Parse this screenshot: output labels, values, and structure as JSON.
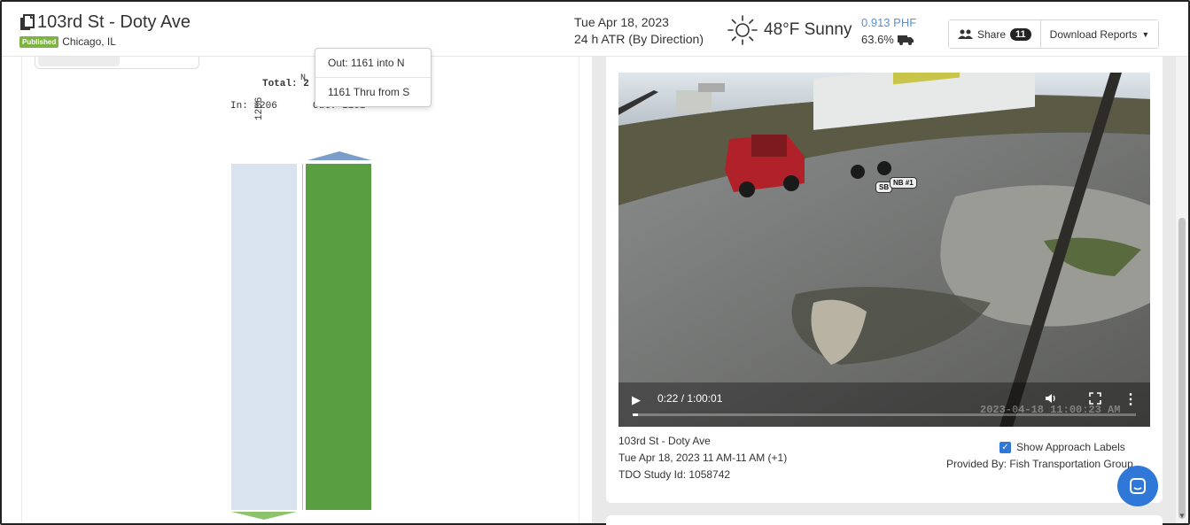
{
  "header": {
    "title": "103rd St - Doty Ave",
    "badge": "Published",
    "location": "Chicago, IL",
    "date": "Tue Apr 18, 2023",
    "study_type": "24 h ATR (By Direction)",
    "weather": "48°F Sunny",
    "phf": "0.913 PHF",
    "truck_pct": "63.6%",
    "share_label": "Share",
    "share_count": "11",
    "download_label": "Download Reports"
  },
  "diagram": {
    "n_label": "N",
    "total_label": "Total: 2",
    "in_label": "In: 1206",
    "out_label": "Out: 1161",
    "vertical_in": "1206",
    "tooltip_out": "Out: 1161 into N",
    "tooltip_thru": "1161 Thru from S"
  },
  "video": {
    "time": "0:22 / 1:00:01",
    "progress": 0.006,
    "timestamp": "2023-04-18 11:00:23 AM",
    "approach_nb": "NB #1",
    "approach_sb": "SB",
    "icons": [
      "play-icon",
      "volume-icon",
      "fullscreen-icon",
      "more-icon"
    ]
  },
  "video_meta": {
    "location": "103rd St - Doty Ave",
    "time_range": "Tue Apr 18, 2023 11 AM-11 AM (+1)",
    "study_id": "TDO Study Id: 1058742",
    "show_labels": "Show Approach Labels",
    "provided_by": "Provided By: Fish Transportation Group"
  },
  "colors": {
    "in_bar": "#d9e3f0",
    "out_bar": "#5a9e42",
    "accent": "#2f78d8",
    "badge": "#7cb342",
    "phf": "#5b8fd6"
  }
}
